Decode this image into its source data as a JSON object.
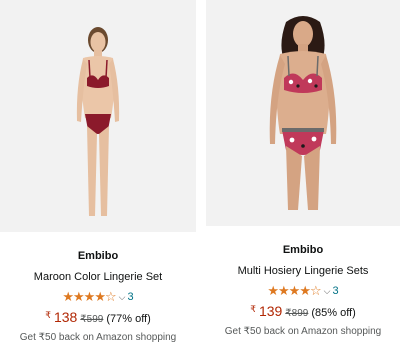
{
  "products": [
    {
      "brand": "Embibo",
      "title": "Maroon Color Lingerie Set",
      "stars": "★★★★☆",
      "chevron": "⌵",
      "rating_count": "3",
      "currency": "₹",
      "price": "138",
      "mrp": "₹599",
      "discount": "(77% off)",
      "cashback": "Get ₹50 back on Amazon shopping"
    },
    {
      "brand": "Embibo",
      "title": "Multi Hosiery Lingerie Sets",
      "stars": "★★★★☆",
      "chevron": "⌵",
      "rating_count": "3",
      "currency": "₹",
      "price": "139",
      "mrp": "₹899",
      "discount": "(85% off)",
      "cashback": "Get ₹50 back on Amazon shopping"
    }
  ],
  "colors": {
    "price": "#b12704",
    "star": "#de7921",
    "link": "#007185",
    "maroon": "#8b1a2b",
    "print_pink": "#c0395a"
  }
}
